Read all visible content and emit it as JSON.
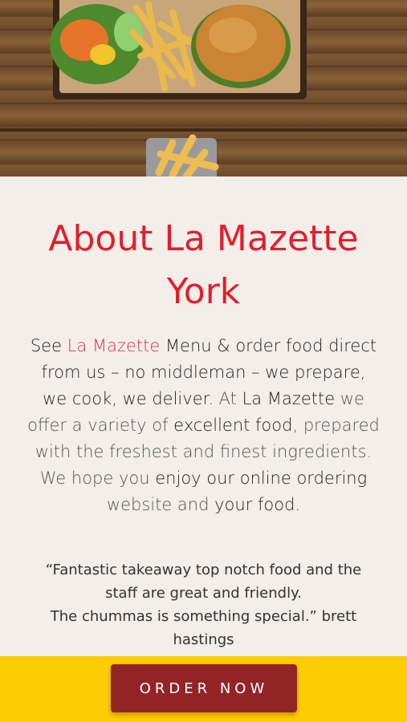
{
  "about": {
    "title_line1": "About La Mazette",
    "title_line2": "York",
    "intro": {
      "p1": "See ",
      "brand": "La Mazette",
      "p2": " Menu & order food direct from us – no middleman – we prepare, we cook, we deliver.",
      "p3": " At ",
      "p4": "La Mazette",
      "p5": " we offer a variety of ",
      "p6": "excellent food",
      "p7": ", prepared with the freshest and finest ingredients. We hope you ",
      "p8": "enjoy our online ordering",
      "p9": " website and ",
      "p10": "your food."
    }
  },
  "testimonial": {
    "line1": "“Fantastic takeaway top notch food and the staff are great and friendly.",
    "line2": "The chummas is something special.” brett hastings"
  },
  "footer": {
    "order_label": "ORDER NOW"
  },
  "colors": {
    "title": "#e01f2b",
    "brand_link": "#d6344f",
    "footer_bar": "#fdcc02",
    "order_button": "#932426",
    "page_background": "#f3eeea"
  }
}
